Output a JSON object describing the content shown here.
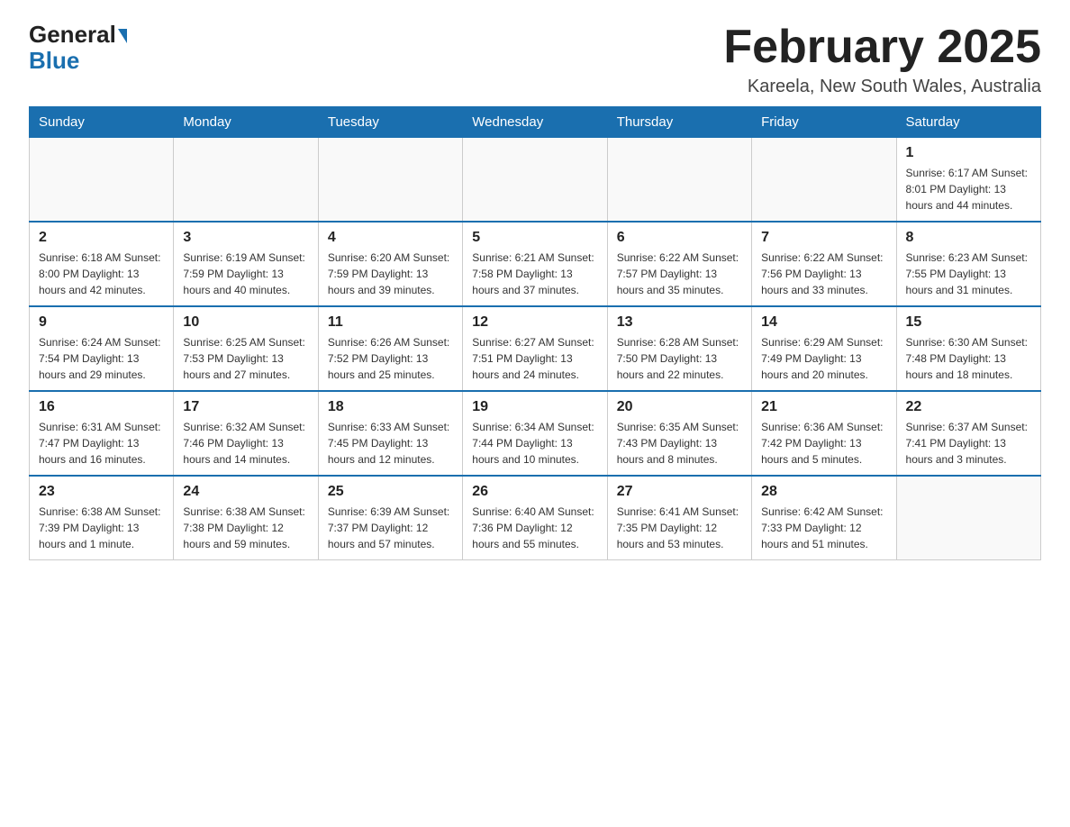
{
  "header": {
    "logo_general": "General",
    "logo_blue": "Blue",
    "month_title": "February 2025",
    "location": "Kareela, New South Wales, Australia"
  },
  "days_of_week": [
    "Sunday",
    "Monday",
    "Tuesday",
    "Wednesday",
    "Thursday",
    "Friday",
    "Saturday"
  ],
  "weeks": [
    [
      {
        "day": "",
        "info": ""
      },
      {
        "day": "",
        "info": ""
      },
      {
        "day": "",
        "info": ""
      },
      {
        "day": "",
        "info": ""
      },
      {
        "day": "",
        "info": ""
      },
      {
        "day": "",
        "info": ""
      },
      {
        "day": "1",
        "info": "Sunrise: 6:17 AM\nSunset: 8:01 PM\nDaylight: 13 hours and 44 minutes."
      }
    ],
    [
      {
        "day": "2",
        "info": "Sunrise: 6:18 AM\nSunset: 8:00 PM\nDaylight: 13 hours and 42 minutes."
      },
      {
        "day": "3",
        "info": "Sunrise: 6:19 AM\nSunset: 7:59 PM\nDaylight: 13 hours and 40 minutes."
      },
      {
        "day": "4",
        "info": "Sunrise: 6:20 AM\nSunset: 7:59 PM\nDaylight: 13 hours and 39 minutes."
      },
      {
        "day": "5",
        "info": "Sunrise: 6:21 AM\nSunset: 7:58 PM\nDaylight: 13 hours and 37 minutes."
      },
      {
        "day": "6",
        "info": "Sunrise: 6:22 AM\nSunset: 7:57 PM\nDaylight: 13 hours and 35 minutes."
      },
      {
        "day": "7",
        "info": "Sunrise: 6:22 AM\nSunset: 7:56 PM\nDaylight: 13 hours and 33 minutes."
      },
      {
        "day": "8",
        "info": "Sunrise: 6:23 AM\nSunset: 7:55 PM\nDaylight: 13 hours and 31 minutes."
      }
    ],
    [
      {
        "day": "9",
        "info": "Sunrise: 6:24 AM\nSunset: 7:54 PM\nDaylight: 13 hours and 29 minutes."
      },
      {
        "day": "10",
        "info": "Sunrise: 6:25 AM\nSunset: 7:53 PM\nDaylight: 13 hours and 27 minutes."
      },
      {
        "day": "11",
        "info": "Sunrise: 6:26 AM\nSunset: 7:52 PM\nDaylight: 13 hours and 25 minutes."
      },
      {
        "day": "12",
        "info": "Sunrise: 6:27 AM\nSunset: 7:51 PM\nDaylight: 13 hours and 24 minutes."
      },
      {
        "day": "13",
        "info": "Sunrise: 6:28 AM\nSunset: 7:50 PM\nDaylight: 13 hours and 22 minutes."
      },
      {
        "day": "14",
        "info": "Sunrise: 6:29 AM\nSunset: 7:49 PM\nDaylight: 13 hours and 20 minutes."
      },
      {
        "day": "15",
        "info": "Sunrise: 6:30 AM\nSunset: 7:48 PM\nDaylight: 13 hours and 18 minutes."
      }
    ],
    [
      {
        "day": "16",
        "info": "Sunrise: 6:31 AM\nSunset: 7:47 PM\nDaylight: 13 hours and 16 minutes."
      },
      {
        "day": "17",
        "info": "Sunrise: 6:32 AM\nSunset: 7:46 PM\nDaylight: 13 hours and 14 minutes."
      },
      {
        "day": "18",
        "info": "Sunrise: 6:33 AM\nSunset: 7:45 PM\nDaylight: 13 hours and 12 minutes."
      },
      {
        "day": "19",
        "info": "Sunrise: 6:34 AM\nSunset: 7:44 PM\nDaylight: 13 hours and 10 minutes."
      },
      {
        "day": "20",
        "info": "Sunrise: 6:35 AM\nSunset: 7:43 PM\nDaylight: 13 hours and 8 minutes."
      },
      {
        "day": "21",
        "info": "Sunrise: 6:36 AM\nSunset: 7:42 PM\nDaylight: 13 hours and 5 minutes."
      },
      {
        "day": "22",
        "info": "Sunrise: 6:37 AM\nSunset: 7:41 PM\nDaylight: 13 hours and 3 minutes."
      }
    ],
    [
      {
        "day": "23",
        "info": "Sunrise: 6:38 AM\nSunset: 7:39 PM\nDaylight: 13 hours and 1 minute."
      },
      {
        "day": "24",
        "info": "Sunrise: 6:38 AM\nSunset: 7:38 PM\nDaylight: 12 hours and 59 minutes."
      },
      {
        "day": "25",
        "info": "Sunrise: 6:39 AM\nSunset: 7:37 PM\nDaylight: 12 hours and 57 minutes."
      },
      {
        "day": "26",
        "info": "Sunrise: 6:40 AM\nSunset: 7:36 PM\nDaylight: 12 hours and 55 minutes."
      },
      {
        "day": "27",
        "info": "Sunrise: 6:41 AM\nSunset: 7:35 PM\nDaylight: 12 hours and 53 minutes."
      },
      {
        "day": "28",
        "info": "Sunrise: 6:42 AM\nSunset: 7:33 PM\nDaylight: 12 hours and 51 minutes."
      },
      {
        "day": "",
        "info": ""
      }
    ]
  ]
}
